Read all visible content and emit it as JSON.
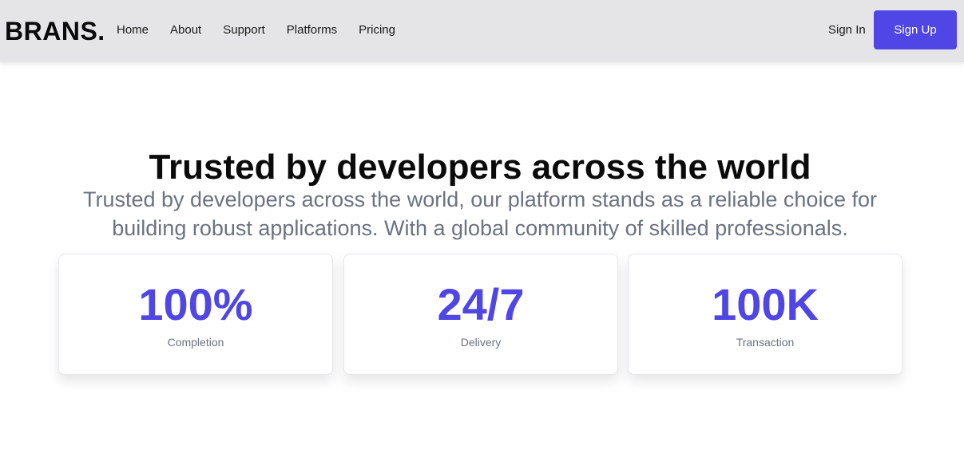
{
  "header": {
    "brand": "BRANS.",
    "nav": [
      "Home",
      "About",
      "Support",
      "Platforms",
      "Pricing"
    ],
    "sign_in": "Sign In",
    "sign_up": "Sign Up"
  },
  "hero": {
    "title": "Trusted by developers across the world",
    "subtitle": "Trusted by developers across the world, our platform stands as a reliable choice for building robust applications. With a global community of skilled professionals."
  },
  "stats": [
    {
      "value": "100%",
      "label": "Completion"
    },
    {
      "value": "24/7",
      "label": "Delivery"
    },
    {
      "value": "100K",
      "label": "Transaction"
    }
  ],
  "colors": {
    "accent": "#4f46e5",
    "nav_bg": "#e5e5e7",
    "muted_text": "#6b7280"
  }
}
